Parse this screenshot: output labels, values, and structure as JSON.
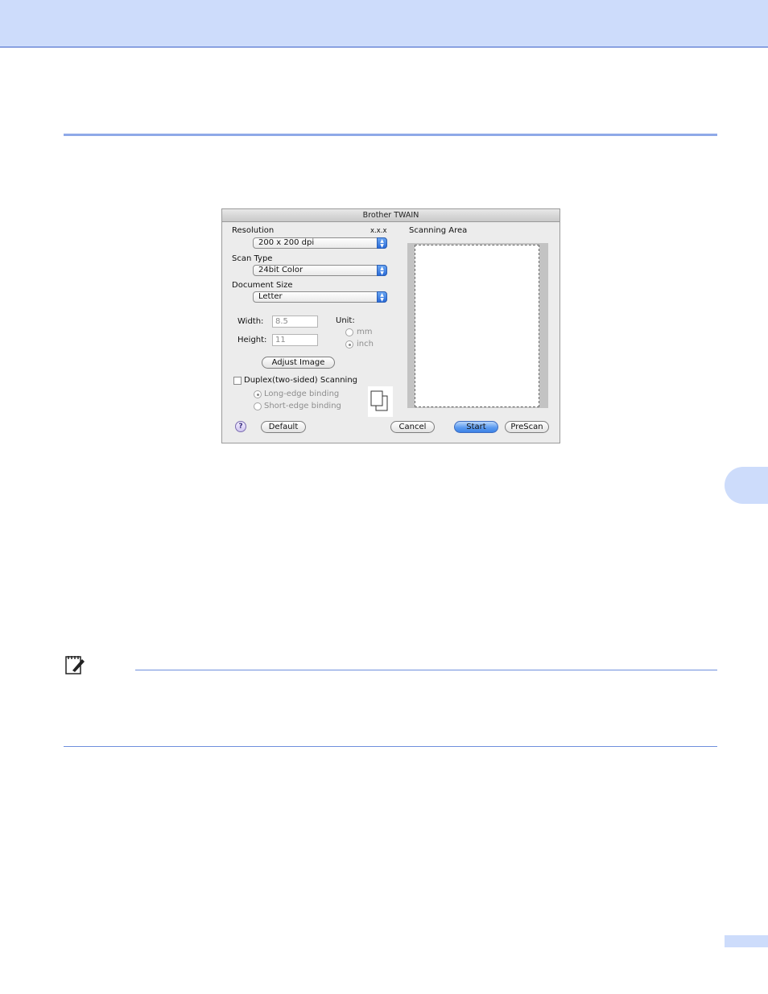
{
  "dialog": {
    "title": "Brother TWAIN",
    "resolution_label": "Resolution",
    "version": "x.x.x",
    "resolution_value": "200 x 200 dpi",
    "scan_type_label": "Scan Type",
    "scan_type_value": "24bit Color",
    "document_size_label": "Document Size",
    "document_size_value": "Letter",
    "width_label": "Width:",
    "width_value": "8.5",
    "height_label": "Height:",
    "height_value": "11",
    "unit_label": "Unit:",
    "unit_options": [
      "mm",
      "inch"
    ],
    "unit_selected": "inch",
    "adjust_image_label": "Adjust Image",
    "duplex_label": "Duplex(two-sided) Scanning",
    "duplex_checked": false,
    "binding_options": [
      "Long-edge binding",
      "Short-edge binding"
    ],
    "binding_selected": "Long-edge binding",
    "scanning_area_label": "Scanning Area",
    "help_label": "?",
    "default_label": "Default",
    "cancel_label": "Cancel",
    "start_label": "Start",
    "prescan_label": "PreScan"
  },
  "colors": {
    "header_band": "#cddcfb",
    "rule": "#8fa9e8",
    "default_button": "#5d9cf0"
  }
}
